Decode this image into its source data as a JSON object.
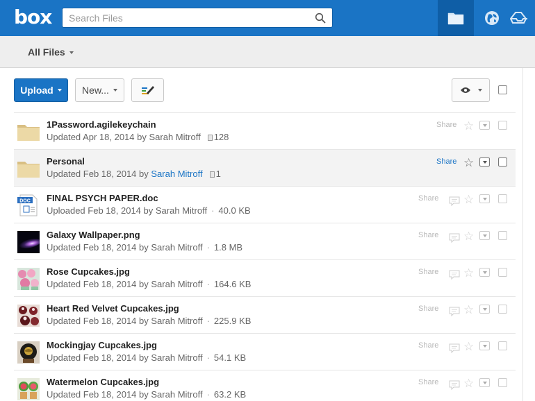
{
  "header": {
    "logo": "box",
    "search_placeholder": "Search Files"
  },
  "breadcrumb": {
    "label": "All Files"
  },
  "toolbar": {
    "upload_label": "Upload",
    "new_label": "New..."
  },
  "files": [
    {
      "name": "1Password.agilekeychain",
      "verb": "Updated",
      "date": "Apr 18, 2014",
      "by": "by",
      "owner": "Sarah Mitroff",
      "detail": "128",
      "type": "folder",
      "share": "Share"
    },
    {
      "name": "Personal",
      "verb": "Updated",
      "date": "Feb 18, 2014",
      "by": "by",
      "owner": "Sarah Mitroff",
      "detail": "1",
      "type": "folder",
      "share": "Share"
    },
    {
      "name": "FINAL PSYCH PAPER.doc",
      "verb": "Uploaded",
      "date": "Feb 18, 2014",
      "by": "by",
      "owner": "Sarah Mitroff",
      "detail": "40.0 KB",
      "type": "doc",
      "share": "Share"
    },
    {
      "name": "Galaxy Wallpaper.png",
      "verb": "Updated",
      "date": "Feb 18, 2014",
      "by": "by",
      "owner": "Sarah Mitroff",
      "detail": "1.8 MB",
      "type": "image",
      "share": "Share"
    },
    {
      "name": "Rose Cupcakes.jpg",
      "verb": "Updated",
      "date": "Feb 18, 2014",
      "by": "by",
      "owner": "Sarah Mitroff",
      "detail": "164.6 KB",
      "type": "image",
      "share": "Share"
    },
    {
      "name": "Heart Red Velvet Cupcakes.jpg",
      "verb": "Updated",
      "date": "Feb 18, 2014",
      "by": "by",
      "owner": "Sarah Mitroff",
      "detail": "225.9 KB",
      "type": "image",
      "share": "Share"
    },
    {
      "name": "Mockingjay Cupcakes.jpg",
      "verb": "Updated",
      "date": "Feb 18, 2014",
      "by": "by",
      "owner": "Sarah Mitroff",
      "detail": "54.1 KB",
      "type": "image",
      "share": "Share"
    },
    {
      "name": "Watermelon Cupcakes.jpg",
      "verb": "Updated",
      "date": "Feb 18, 2014",
      "by": "by",
      "owner": "Sarah Mitroff",
      "detail": "63.2 KB",
      "type": "image",
      "share": "Share"
    }
  ],
  "icons": {
    "nav": [
      "folder-icon",
      "globe-icon",
      "box-sync-icon"
    ],
    "doc_badge": "DOC"
  },
  "colors": {
    "brand": "#1a74c5",
    "brand_dark": "#0f5ea6"
  }
}
